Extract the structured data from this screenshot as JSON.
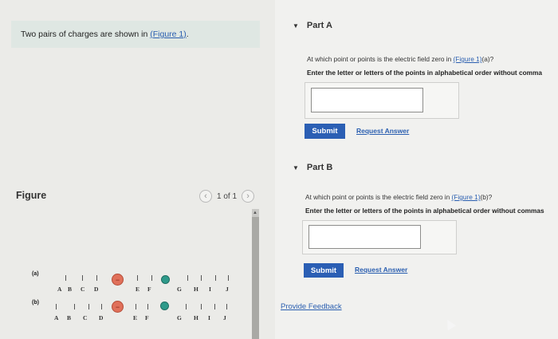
{
  "intro": {
    "text": "Two pairs of charges are shown in ",
    "link": "(Figure 1)",
    "suffix": "."
  },
  "figure": {
    "label": "Figure",
    "pager": "1 of 1",
    "prev_icon": "chevron-left-icon",
    "next_icon": "chevron-right-icon",
    "rows": [
      {
        "tag": "(a)",
        "labels": [
          "A",
          "B",
          "C",
          "D",
          "E",
          "F",
          "G",
          "H",
          "I",
          "J"
        ]
      },
      {
        "tag": "(b)",
        "labels": [
          "A",
          "B",
          "C",
          "D",
          "E",
          "F",
          "G",
          "H",
          "I",
          "J"
        ]
      }
    ],
    "colors": {
      "negative": "#e0705a",
      "positive": "#2e9a8a"
    }
  },
  "partA": {
    "title": "Part A",
    "question_pre": "At which point or points is the electric field zero in ",
    "question_link": "(Figure 1)",
    "question_post": "(a)?",
    "instruction": "Enter the letter or letters of the points in alphabetical order without comma",
    "submit": "Submit",
    "request": "Request Answer"
  },
  "partB": {
    "title": "Part B",
    "question_pre": "At which point or points is the electric field zero in ",
    "question_link": "(Figure 1)",
    "question_post": "(b)?",
    "instruction": "Enter the letter or letters of the points in alphabetical order without commas",
    "submit": "Submit",
    "request": "Request Answer"
  },
  "feedback": "Provide Feedback",
  "accent": "#2b5fb4"
}
